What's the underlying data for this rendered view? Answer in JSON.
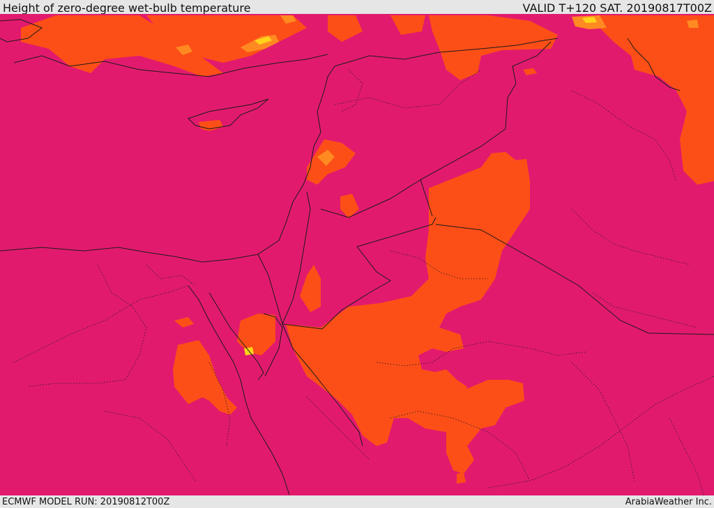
{
  "header": {
    "title": "Height of zero-degree wet-bulb temperature",
    "valid": "VALID T+120 SAT. 20190817T00Z"
  },
  "footer": {
    "model_run": "ECMWF MODEL RUN: 20190812T00Z",
    "credit": "ArabiaWeather Inc."
  },
  "colors": {
    "base_field": "#e21a6e",
    "orange_field": "#fc4f17",
    "light_orange_field": "#ff8a21",
    "yellow_field": "#ffd31a",
    "border_lines": "#1a1a1a",
    "frame": "#e6e6e6"
  }
}
